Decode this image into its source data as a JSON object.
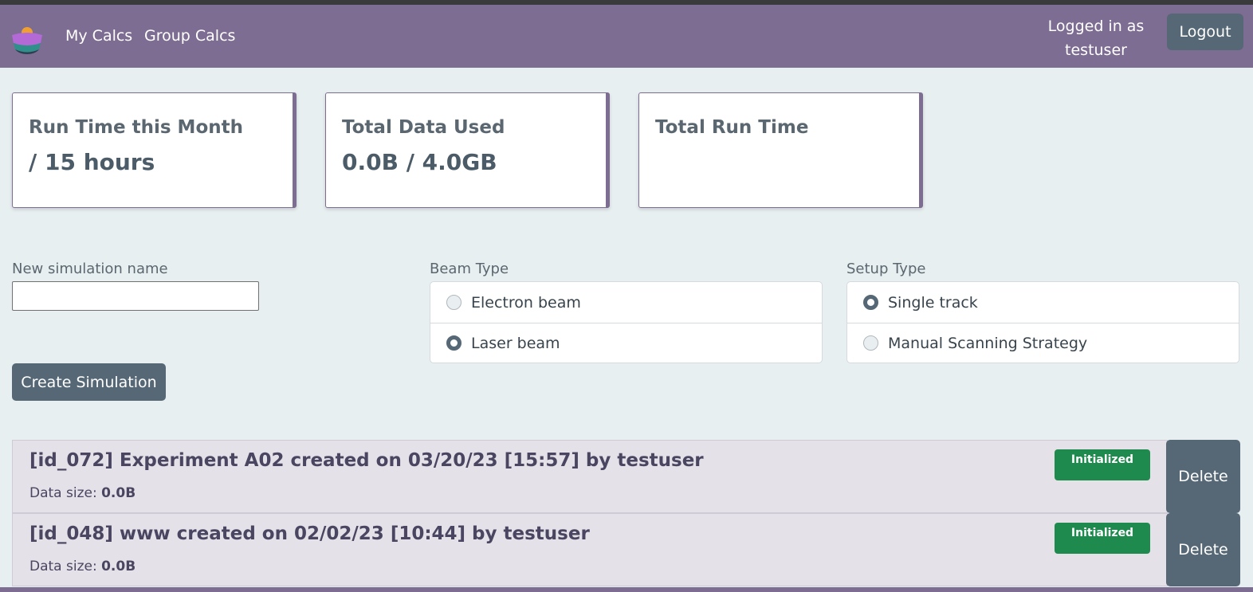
{
  "colors": {
    "brand_purple": "#7e6d92",
    "button_slate": "#566876",
    "status_green": "#1e8a4e",
    "page_background": "#e8eff1"
  },
  "navbar": {
    "logo_icon": "stacked-bowl-logo-icon",
    "links": [
      "My Calcs",
      "Group Calcs"
    ],
    "logged_in_line1": "Logged in as",
    "logged_in_user": "testuser",
    "logout_label": "Logout"
  },
  "stats": [
    {
      "title": "Run Time this Month",
      "value": "/ 15 hours"
    },
    {
      "title": "Total Data Used",
      "value": "0.0B / 4.0GB"
    },
    {
      "title": "Total Run Time",
      "value": ""
    }
  ],
  "form": {
    "name_label": "New simulation name",
    "name_value": "",
    "beam": {
      "label": "Beam Type",
      "options": [
        "Electron beam",
        "Laser beam"
      ],
      "selected": "Laser beam"
    },
    "setup": {
      "label": "Setup Type",
      "options": [
        "Single track",
        "Manual Scanning Strategy"
      ],
      "selected": "Single track"
    },
    "create_label": "Create Simulation"
  },
  "simulations": [
    {
      "title": "[id_072] Experiment A02 created on 03/20/23 [15:57] by testuser",
      "size_label": "Data size:",
      "size_value": "0.0B",
      "status": "Initialized",
      "delete_label": "Delete"
    },
    {
      "title": "[id_048] www created on 02/02/23 [10:44] by testuser",
      "size_label": "Data size:",
      "size_value": "0.0B",
      "status": "Initialized",
      "delete_label": "Delete"
    }
  ]
}
